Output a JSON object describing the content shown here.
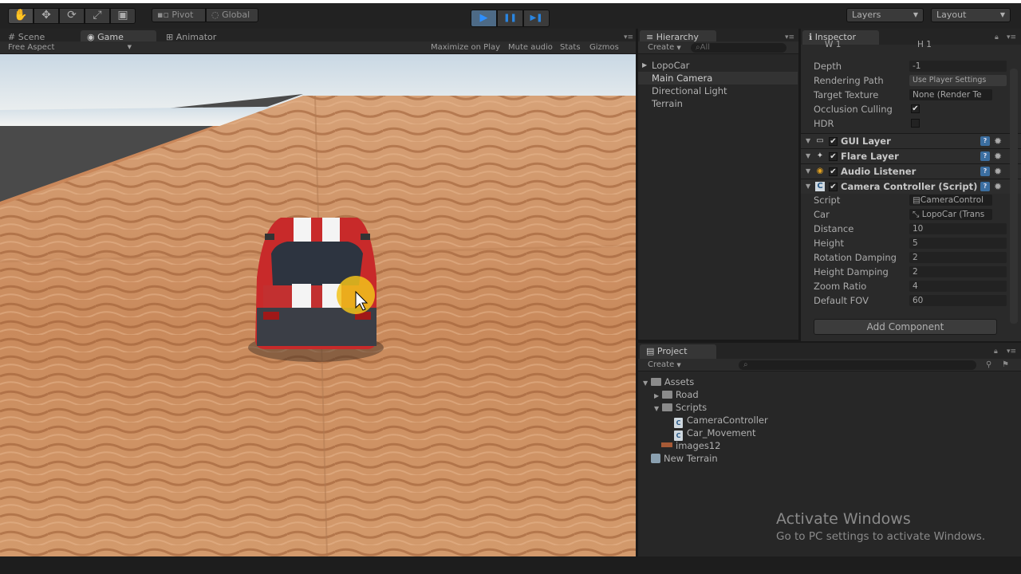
{
  "toolbar": {
    "tools": [
      "✋",
      "✥",
      "⟳",
      "⤢",
      "▣"
    ],
    "pivot_label": "Pivot",
    "global_label": "Global",
    "play_icons": [
      "▶",
      "❚❚",
      "▶❚"
    ],
    "layers_label": "Layers",
    "layout_label": "Layout"
  },
  "game_panel": {
    "tabs": [
      "Scene",
      "Game",
      "Animator"
    ],
    "aspect": "Free Aspect",
    "options": [
      "Maximize on Play",
      "Mute audio",
      "Stats",
      "Gizmos"
    ]
  },
  "hierarchy": {
    "tab": "Hierarchy",
    "create": "Create",
    "search_placeholder": "All",
    "items": [
      "LopoCar",
      "Main Camera",
      "Directional Light",
      "Terrain"
    ]
  },
  "inspector": {
    "tab": "Inspector",
    "viewport": {
      "w": "W 1",
      "h": "H 1"
    },
    "camera_props": [
      {
        "label": "Depth",
        "value": "-1"
      },
      {
        "label": "Rendering Path",
        "value": "Use Player Settings"
      },
      {
        "label": "Target Texture",
        "value": "None (Render Te"
      },
      {
        "label": "Occlusion Culling",
        "value": "✔"
      },
      {
        "label": "HDR",
        "value": ""
      }
    ],
    "components": [
      "GUI Layer",
      "Flare Layer",
      "Audio Listener",
      "Camera Controller (Script)"
    ],
    "script_props": [
      {
        "label": "Script",
        "value": "CameraControl"
      },
      {
        "label": "Car",
        "value": "LopoCar (Trans"
      },
      {
        "label": "Distance",
        "value": "10"
      },
      {
        "label": "Height",
        "value": "5"
      },
      {
        "label": "Rotation Damping",
        "value": "2"
      },
      {
        "label": "Height Damping",
        "value": "2"
      },
      {
        "label": "Zoom Ratio",
        "value": "4"
      },
      {
        "label": "Default FOV",
        "value": "60"
      }
    ],
    "add_component": "Add Component"
  },
  "project": {
    "tab": "Project",
    "create": "Create",
    "tree": {
      "assets": "Assets",
      "road": "Road",
      "scripts": "Scripts",
      "camera_controller": "CameraController",
      "car_movement": "Car_Movement",
      "images": "images12",
      "new_terrain": "New Terrain"
    }
  },
  "watermark": {
    "line1": "Activate Windows",
    "line2": "Go to PC settings to activate Windows."
  },
  "colors": {
    "accent": "#2e8fff",
    "panel": "#272727",
    "sand": "#d29a6c"
  }
}
